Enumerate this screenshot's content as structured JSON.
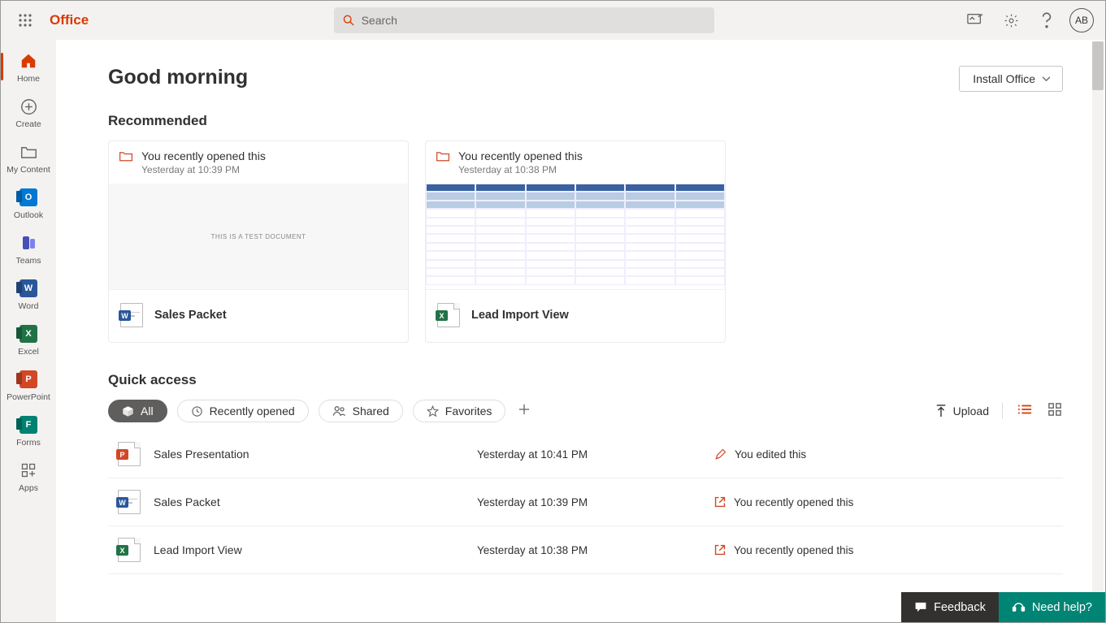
{
  "brand": "Office",
  "search": {
    "placeholder": "Search"
  },
  "avatar_initials": "AB",
  "install_btn": "Install Office",
  "nav": [
    {
      "id": "home",
      "label": "Home"
    },
    {
      "id": "create",
      "label": "Create"
    },
    {
      "id": "content",
      "label": "My Content"
    },
    {
      "id": "outlook",
      "label": "Outlook"
    },
    {
      "id": "teams",
      "label": "Teams"
    },
    {
      "id": "word",
      "label": "Word"
    },
    {
      "id": "excel",
      "label": "Excel"
    },
    {
      "id": "ppt",
      "label": "PowerPoint"
    },
    {
      "id": "forms",
      "label": "Forms"
    },
    {
      "id": "apps",
      "label": "Apps"
    }
  ],
  "greeting": "Good morning",
  "recommended": {
    "heading": "Recommended",
    "cards": [
      {
        "reason": "You recently opened this",
        "time": "Yesterday at 10:39 PM",
        "title": "Sales Packet",
        "type": "word",
        "preview_text": "THIS IS A TEST DOCUMENT"
      },
      {
        "reason": "You recently opened this",
        "time": "Yesterday at 10:38 PM",
        "title": "Lead Import View",
        "type": "excel"
      }
    ]
  },
  "quick_access": {
    "heading": "Quick access",
    "filters": {
      "all": "All",
      "recent": "Recently opened",
      "shared": "Shared",
      "favorites": "Favorites"
    },
    "upload_label": "Upload",
    "rows": [
      {
        "name": "Sales Presentation",
        "time": "Yesterday at 10:41 PM",
        "action": "You edited this",
        "type": "ppt",
        "act_icon": "edit"
      },
      {
        "name": "Sales Packet",
        "time": "Yesterday at 10:39 PM",
        "action": "You recently opened this",
        "type": "word",
        "act_icon": "open"
      },
      {
        "name": "Lead Import View",
        "time": "Yesterday at 10:38 PM",
        "action": "You recently opened this",
        "type": "excel",
        "act_icon": "open"
      }
    ]
  },
  "bottom": {
    "feedback": "Feedback",
    "help": "Need help?"
  }
}
